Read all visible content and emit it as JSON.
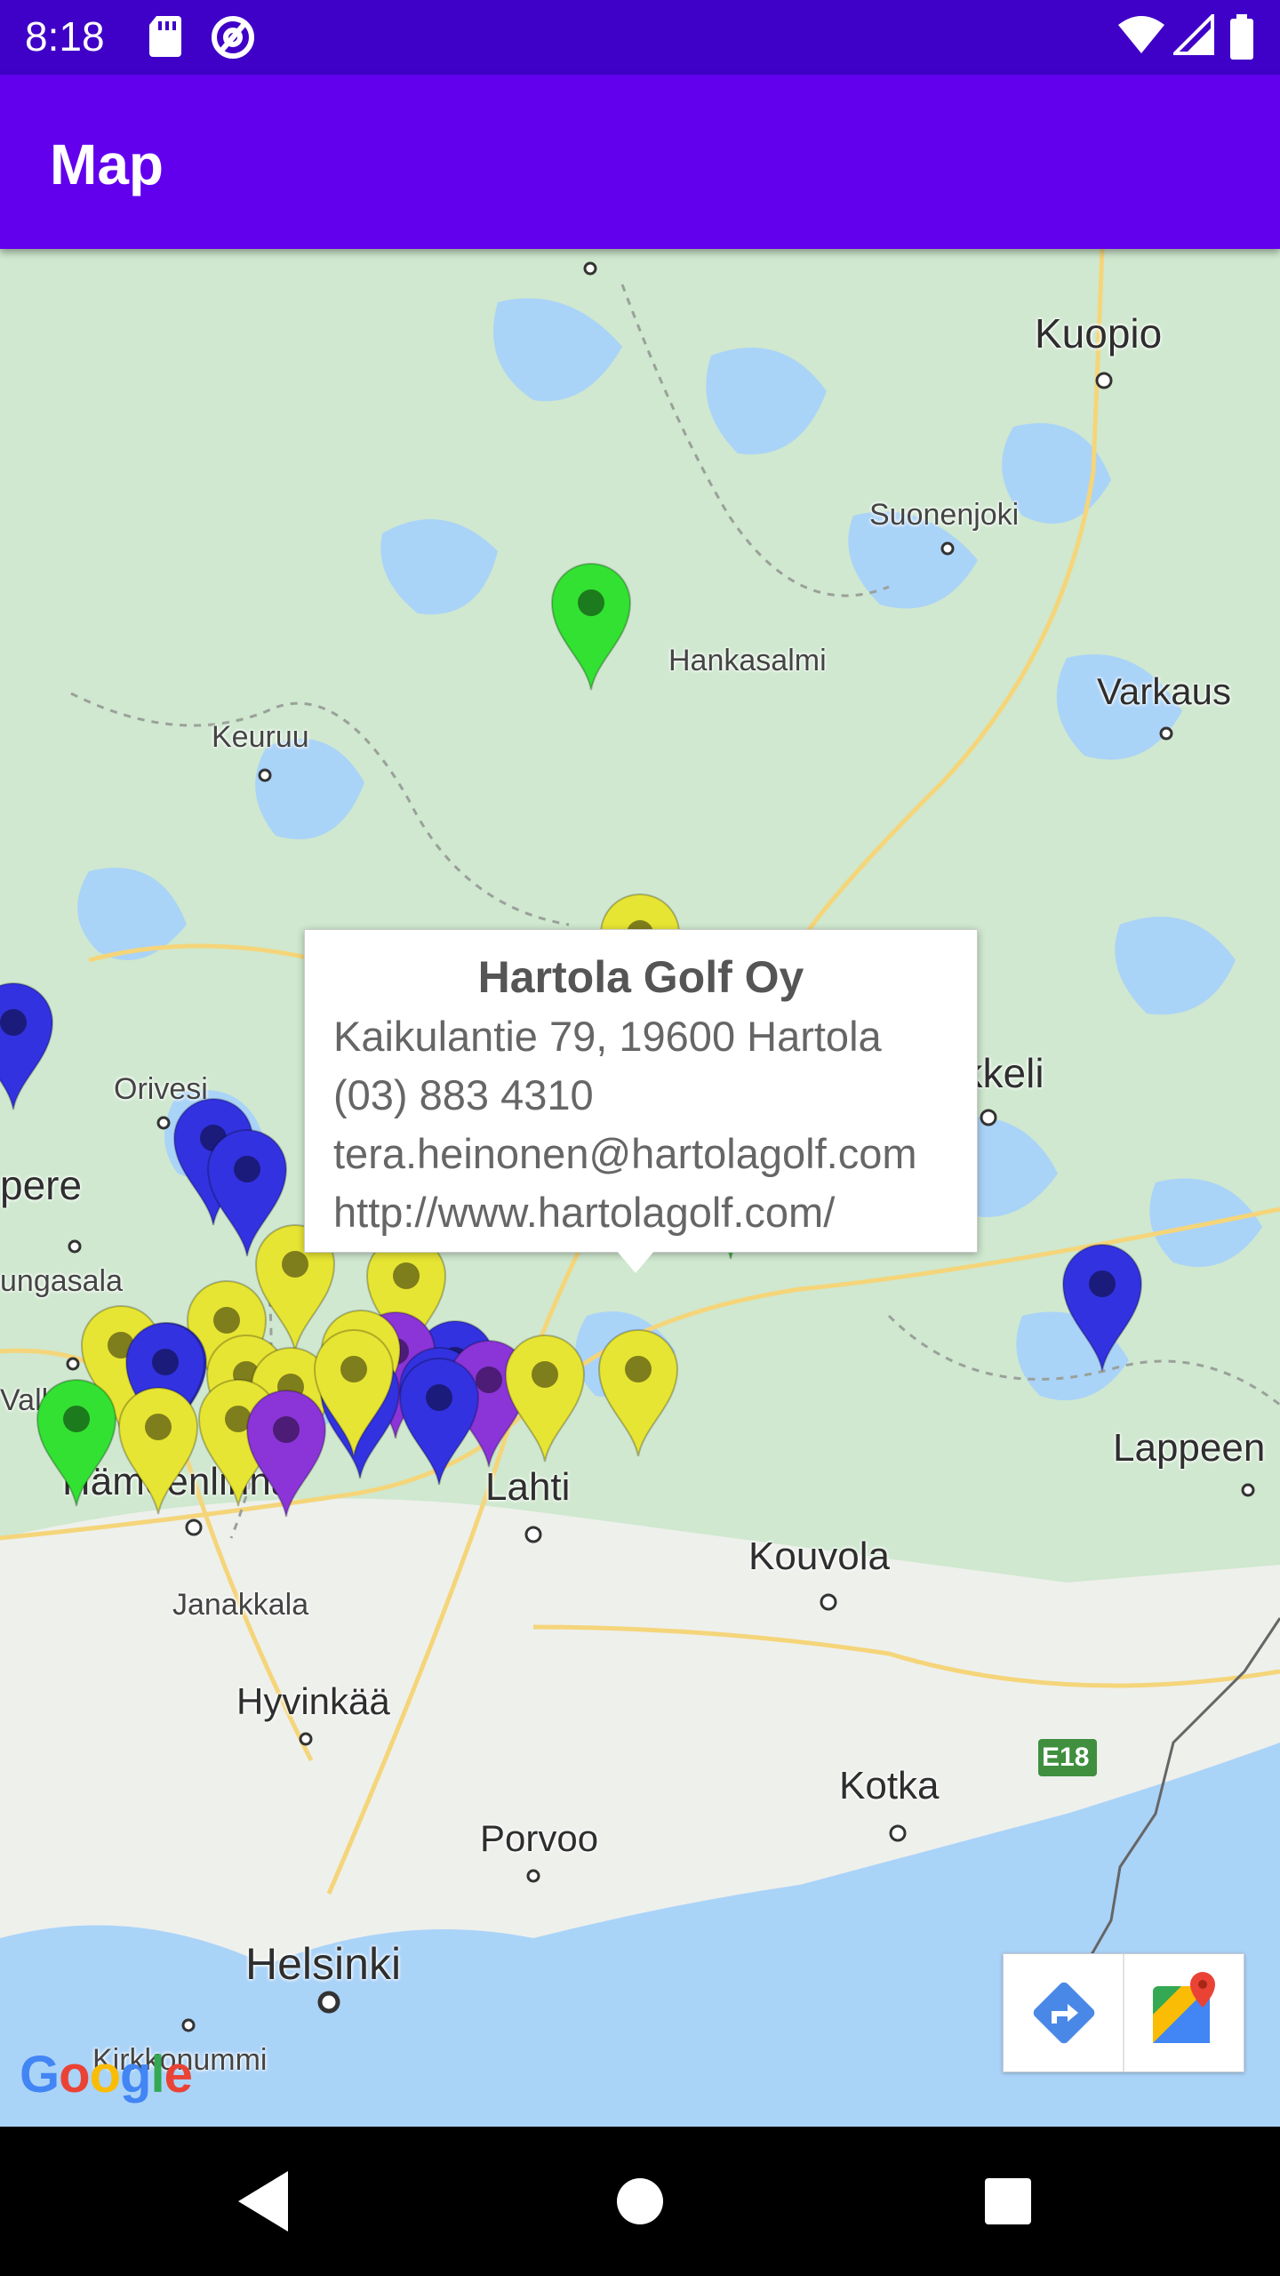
{
  "status_bar": {
    "time": "8:18",
    "icons": [
      "sd-card-icon",
      "at-sign-icon",
      "wifi-icon",
      "signal-icon",
      "battery-icon"
    ]
  },
  "app_bar": {
    "title": "Map"
  },
  "map": {
    "labels": [
      {
        "text": "Kuopio",
        "kind": "city"
      },
      {
        "text": "Suonenjoki",
        "kind": "town"
      },
      {
        "text": "Hankasalmi",
        "kind": "town"
      },
      {
        "text": "Varkaus",
        "kind": "city"
      },
      {
        "text": "Keuruu",
        "kind": "town"
      },
      {
        "text": "Mikkeli",
        "kind": "city"
      },
      {
        "text": "Orivesi",
        "kind": "town"
      },
      {
        "text": "pere",
        "kind": "city"
      },
      {
        "text": "ungasala",
        "kind": "town"
      },
      {
        "text": "Valkeakoski",
        "kind": "town"
      },
      {
        "text": "Hämeenlinna",
        "kind": "city"
      },
      {
        "text": "Lahti",
        "kind": "city"
      },
      {
        "text": "Lappeen",
        "kind": "city"
      },
      {
        "text": "Kouvola",
        "kind": "city"
      },
      {
        "text": "Janakkala",
        "kind": "town"
      },
      {
        "text": "Hyvinkää",
        "kind": "city"
      },
      {
        "text": "Porvoo",
        "kind": "city"
      },
      {
        "text": "Kotka",
        "kind": "city"
      },
      {
        "text": "E18",
        "kind": "road"
      },
      {
        "text": "Helsinki",
        "kind": "city"
      },
      {
        "text": "Kirkkonummi",
        "kind": "town"
      }
    ],
    "marker_colors": {
      "green": "#33e133",
      "yellow": "#e7e533",
      "blue": "#3232e0",
      "purple": "#8b34d8"
    },
    "markers": [
      "green",
      "yellow",
      "blue",
      "blue",
      "blue",
      "blue",
      "green",
      "blue",
      "green",
      "blue",
      "yellow",
      "yellow",
      "yellow",
      "yellow",
      "blue",
      "purple",
      "blue",
      "yellow",
      "yellow",
      "blue",
      "yellow",
      "blue",
      "purple",
      "yellow",
      "yellow",
      "green",
      "yellow",
      "yellow",
      "purple",
      "blue",
      "blue",
      "yellow"
    ]
  },
  "info_window": {
    "title": "Hartola Golf Oy",
    "address": "Kaikulantie 79, 19600 Hartola",
    "phone": "(03) 883 4310",
    "email": "tera.heinonen@hartolagolf.com",
    "website": "http://www.hartolagolf.com/"
  },
  "map_toolbar": {
    "directions_icon": "directions-icon",
    "maps_icon": "google-maps-icon"
  },
  "attribution": "Google",
  "nav_bar": {
    "buttons": [
      "back-icon",
      "home-icon",
      "recents-icon"
    ]
  }
}
